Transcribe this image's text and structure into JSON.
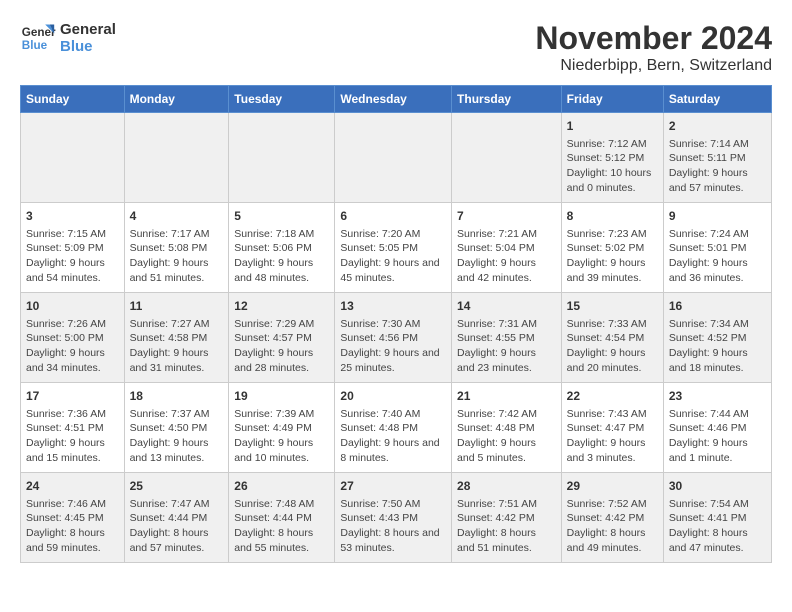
{
  "logo": {
    "line1": "General",
    "line2": "Blue"
  },
  "title": "November 2024",
  "subtitle": "Niederbipp, Bern, Switzerland",
  "days_of_week": [
    "Sunday",
    "Monday",
    "Tuesday",
    "Wednesday",
    "Thursday",
    "Friday",
    "Saturday"
  ],
  "weeks": [
    [
      {
        "day": "",
        "info": ""
      },
      {
        "day": "",
        "info": ""
      },
      {
        "day": "",
        "info": ""
      },
      {
        "day": "",
        "info": ""
      },
      {
        "day": "",
        "info": ""
      },
      {
        "day": "1",
        "info": "Sunrise: 7:12 AM\nSunset: 5:12 PM\nDaylight: 10 hours and 0 minutes."
      },
      {
        "day": "2",
        "info": "Sunrise: 7:14 AM\nSunset: 5:11 PM\nDaylight: 9 hours and 57 minutes."
      }
    ],
    [
      {
        "day": "3",
        "info": "Sunrise: 7:15 AM\nSunset: 5:09 PM\nDaylight: 9 hours and 54 minutes."
      },
      {
        "day": "4",
        "info": "Sunrise: 7:17 AM\nSunset: 5:08 PM\nDaylight: 9 hours and 51 minutes."
      },
      {
        "day": "5",
        "info": "Sunrise: 7:18 AM\nSunset: 5:06 PM\nDaylight: 9 hours and 48 minutes."
      },
      {
        "day": "6",
        "info": "Sunrise: 7:20 AM\nSunset: 5:05 PM\nDaylight: 9 hours and 45 minutes."
      },
      {
        "day": "7",
        "info": "Sunrise: 7:21 AM\nSunset: 5:04 PM\nDaylight: 9 hours and 42 minutes."
      },
      {
        "day": "8",
        "info": "Sunrise: 7:23 AM\nSunset: 5:02 PM\nDaylight: 9 hours and 39 minutes."
      },
      {
        "day": "9",
        "info": "Sunrise: 7:24 AM\nSunset: 5:01 PM\nDaylight: 9 hours and 36 minutes."
      }
    ],
    [
      {
        "day": "10",
        "info": "Sunrise: 7:26 AM\nSunset: 5:00 PM\nDaylight: 9 hours and 34 minutes."
      },
      {
        "day": "11",
        "info": "Sunrise: 7:27 AM\nSunset: 4:58 PM\nDaylight: 9 hours and 31 minutes."
      },
      {
        "day": "12",
        "info": "Sunrise: 7:29 AM\nSunset: 4:57 PM\nDaylight: 9 hours and 28 minutes."
      },
      {
        "day": "13",
        "info": "Sunrise: 7:30 AM\nSunset: 4:56 PM\nDaylight: 9 hours and 25 minutes."
      },
      {
        "day": "14",
        "info": "Sunrise: 7:31 AM\nSunset: 4:55 PM\nDaylight: 9 hours and 23 minutes."
      },
      {
        "day": "15",
        "info": "Sunrise: 7:33 AM\nSunset: 4:54 PM\nDaylight: 9 hours and 20 minutes."
      },
      {
        "day": "16",
        "info": "Sunrise: 7:34 AM\nSunset: 4:52 PM\nDaylight: 9 hours and 18 minutes."
      }
    ],
    [
      {
        "day": "17",
        "info": "Sunrise: 7:36 AM\nSunset: 4:51 PM\nDaylight: 9 hours and 15 minutes."
      },
      {
        "day": "18",
        "info": "Sunrise: 7:37 AM\nSunset: 4:50 PM\nDaylight: 9 hours and 13 minutes."
      },
      {
        "day": "19",
        "info": "Sunrise: 7:39 AM\nSunset: 4:49 PM\nDaylight: 9 hours and 10 minutes."
      },
      {
        "day": "20",
        "info": "Sunrise: 7:40 AM\nSunset: 4:48 PM\nDaylight: 9 hours and 8 minutes."
      },
      {
        "day": "21",
        "info": "Sunrise: 7:42 AM\nSunset: 4:48 PM\nDaylight: 9 hours and 5 minutes."
      },
      {
        "day": "22",
        "info": "Sunrise: 7:43 AM\nSunset: 4:47 PM\nDaylight: 9 hours and 3 minutes."
      },
      {
        "day": "23",
        "info": "Sunrise: 7:44 AM\nSunset: 4:46 PM\nDaylight: 9 hours and 1 minute."
      }
    ],
    [
      {
        "day": "24",
        "info": "Sunrise: 7:46 AM\nSunset: 4:45 PM\nDaylight: 8 hours and 59 minutes."
      },
      {
        "day": "25",
        "info": "Sunrise: 7:47 AM\nSunset: 4:44 PM\nDaylight: 8 hours and 57 minutes."
      },
      {
        "day": "26",
        "info": "Sunrise: 7:48 AM\nSunset: 4:44 PM\nDaylight: 8 hours and 55 minutes."
      },
      {
        "day": "27",
        "info": "Sunrise: 7:50 AM\nSunset: 4:43 PM\nDaylight: 8 hours and 53 minutes."
      },
      {
        "day": "28",
        "info": "Sunrise: 7:51 AM\nSunset: 4:42 PM\nDaylight: 8 hours and 51 minutes."
      },
      {
        "day": "29",
        "info": "Sunrise: 7:52 AM\nSunset: 4:42 PM\nDaylight: 8 hours and 49 minutes."
      },
      {
        "day": "30",
        "info": "Sunrise: 7:54 AM\nSunset: 4:41 PM\nDaylight: 8 hours and 47 minutes."
      }
    ]
  ]
}
